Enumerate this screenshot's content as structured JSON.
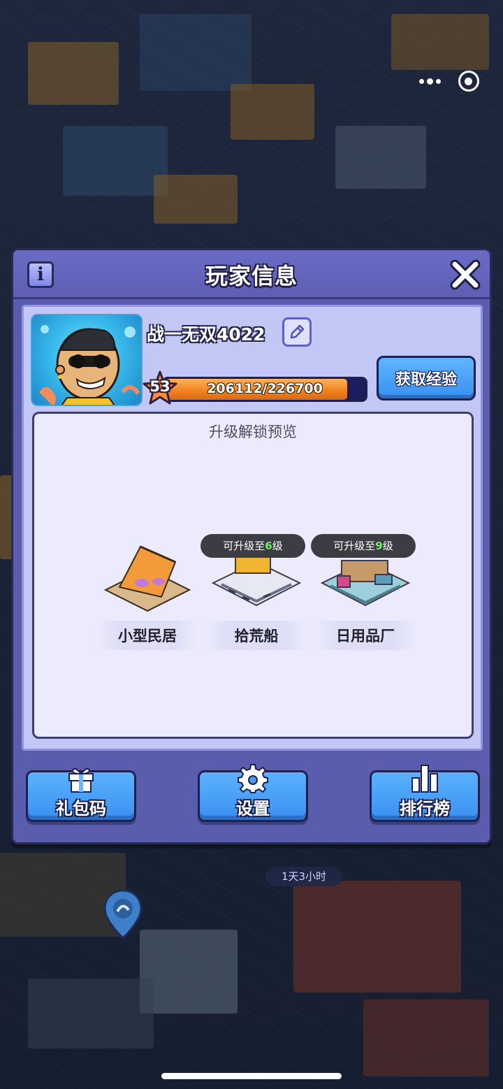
{
  "dialog": {
    "title": "玩家信息",
    "player_name": "战一无双4022",
    "level": "53",
    "xp_text": "206112/226700",
    "xp_progress": 0.909,
    "get_xp_label": "获取经验",
    "preview_title": "升级解锁预览",
    "buildings": [
      {
        "name": "小型民居"
      },
      {
        "name": "拾荒船",
        "badge_prefix": "可升级至",
        "badge_level": "6",
        "badge_suffix": "级"
      },
      {
        "name": "日用品厂",
        "badge_prefix": "可升级至",
        "badge_level": "9",
        "badge_suffix": "级"
      }
    ],
    "buttons": {
      "gift_code": "礼包码",
      "settings": "设置",
      "leaderboard": "排行榜"
    }
  },
  "world": {
    "timer": "1天3小时"
  },
  "colors": {
    "dialog_bg": "#5a5cae",
    "panel_bg": "#c3c7f5",
    "button_blue": "#3a8fef",
    "xp_orange": "#f0801f",
    "badge_green": "#6df06a"
  },
  "icons": [
    "info-icon",
    "close-icon",
    "edit-pencil-icon",
    "star-icon",
    "gift-icon",
    "gear-icon",
    "bar-chart-icon",
    "map-pin-icon"
  ]
}
